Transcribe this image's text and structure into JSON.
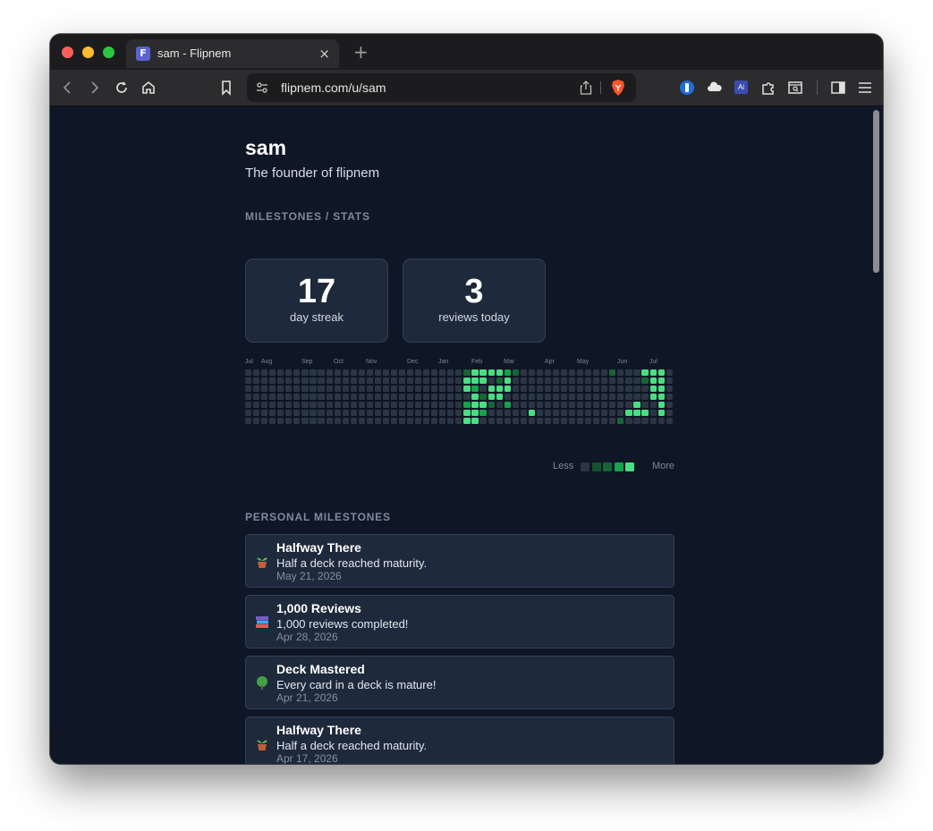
{
  "browser": {
    "tab_title": "sam - Flipnem",
    "favicon_letter": "F",
    "url": "flipnem.com/u/sam"
  },
  "profile": {
    "name": "sam",
    "bio": "The founder of flipnem"
  },
  "sections": {
    "stats_heading": "MILESTONES / STATS",
    "personal_heading": "PERSONAL MILESTONES"
  },
  "stats": [
    {
      "value": "17",
      "label": "day streak"
    },
    {
      "value": "3",
      "label": "reviews today"
    }
  ],
  "heatmap": {
    "months": [
      "Jul",
      "Aug",
      "Sep",
      "Oct",
      "Nov",
      "Dec",
      "Jan",
      "Feb",
      "Mar",
      "Apr",
      "May",
      "Jun",
      "Jul"
    ],
    "weeks": 53,
    "days_per_week": 7,
    "active_weeks": [
      [
        2,
        4,
        4,
        0,
        3,
        4,
        4
      ],
      [
        4,
        4,
        3,
        4,
        4,
        4,
        4
      ],
      [
        4,
        4,
        0,
        2,
        4,
        3,
        0
      ],
      [
        4,
        0,
        4,
        4,
        2,
        0,
        0
      ],
      [
        4,
        2,
        4,
        4,
        0,
        0,
        0
      ],
      [
        3,
        4,
        4,
        0,
        3,
        0,
        0
      ],
      [
        2,
        0,
        0,
        0,
        0,
        0,
        0
      ],
      [
        0,
        0,
        0,
        0,
        0,
        0,
        0
      ],
      [
        0,
        0,
        0,
        0,
        0,
        4,
        0
      ],
      [
        0,
        0,
        0,
        0,
        0,
        0,
        0
      ],
      [
        0,
        0,
        0,
        0,
        0,
        0,
        0
      ],
      [
        0,
        0,
        0,
        0,
        0,
        0,
        0
      ],
      [
        0,
        0,
        0,
        0,
        0,
        0,
        0
      ],
      [
        0,
        0,
        0,
        0,
        0,
        0,
        0
      ],
      [
        0,
        0,
        0,
        0,
        0,
        0,
        0
      ],
      [
        0,
        0,
        0,
        0,
        0,
        0,
        0
      ],
      [
        0,
        0,
        0,
        0,
        0,
        0,
        0
      ],
      [
        0,
        0,
        0,
        0,
        0,
        0,
        0
      ],
      [
        2,
        0,
        0,
        0,
        0,
        0,
        0
      ],
      [
        0,
        0,
        0,
        0,
        0,
        0,
        2
      ],
      [
        0,
        0,
        0,
        0,
        0,
        4,
        0
      ],
      [
        0,
        0,
        0,
        0,
        4,
        4,
        0
      ],
      [
        4,
        2,
        0,
        0,
        0,
        4,
        0
      ],
      [
        4,
        4,
        4,
        4,
        0,
        0,
        0
      ],
      [
        4,
        4,
        4,
        4,
        4,
        4,
        0
      ],
      [
        0,
        0,
        0,
        0,
        0,
        0,
        0
      ]
    ],
    "colors": [
      "#2b3645",
      "#14532d",
      "#166534",
      "#16a34a",
      "#4ade80"
    ],
    "legend_less": "Less",
    "legend_more": "More"
  },
  "milestones": [
    {
      "icon": "potted-plant-icon",
      "title": "Halfway There",
      "desc": "Half a deck reached maturity.",
      "date": "May 21, 2026"
    },
    {
      "icon": "books-icon",
      "title": "1,000 Reviews",
      "desc": "1,000 reviews completed!",
      "date": "Apr 28, 2026"
    },
    {
      "icon": "tree-icon",
      "title": "Deck Mastered",
      "desc": "Every card in a deck is mature!",
      "date": "Apr 21, 2026"
    },
    {
      "icon": "potted-plant-icon",
      "title": "Halfway There",
      "desc": "Half a deck reached maturity.",
      "date": "Apr 17, 2026"
    }
  ]
}
